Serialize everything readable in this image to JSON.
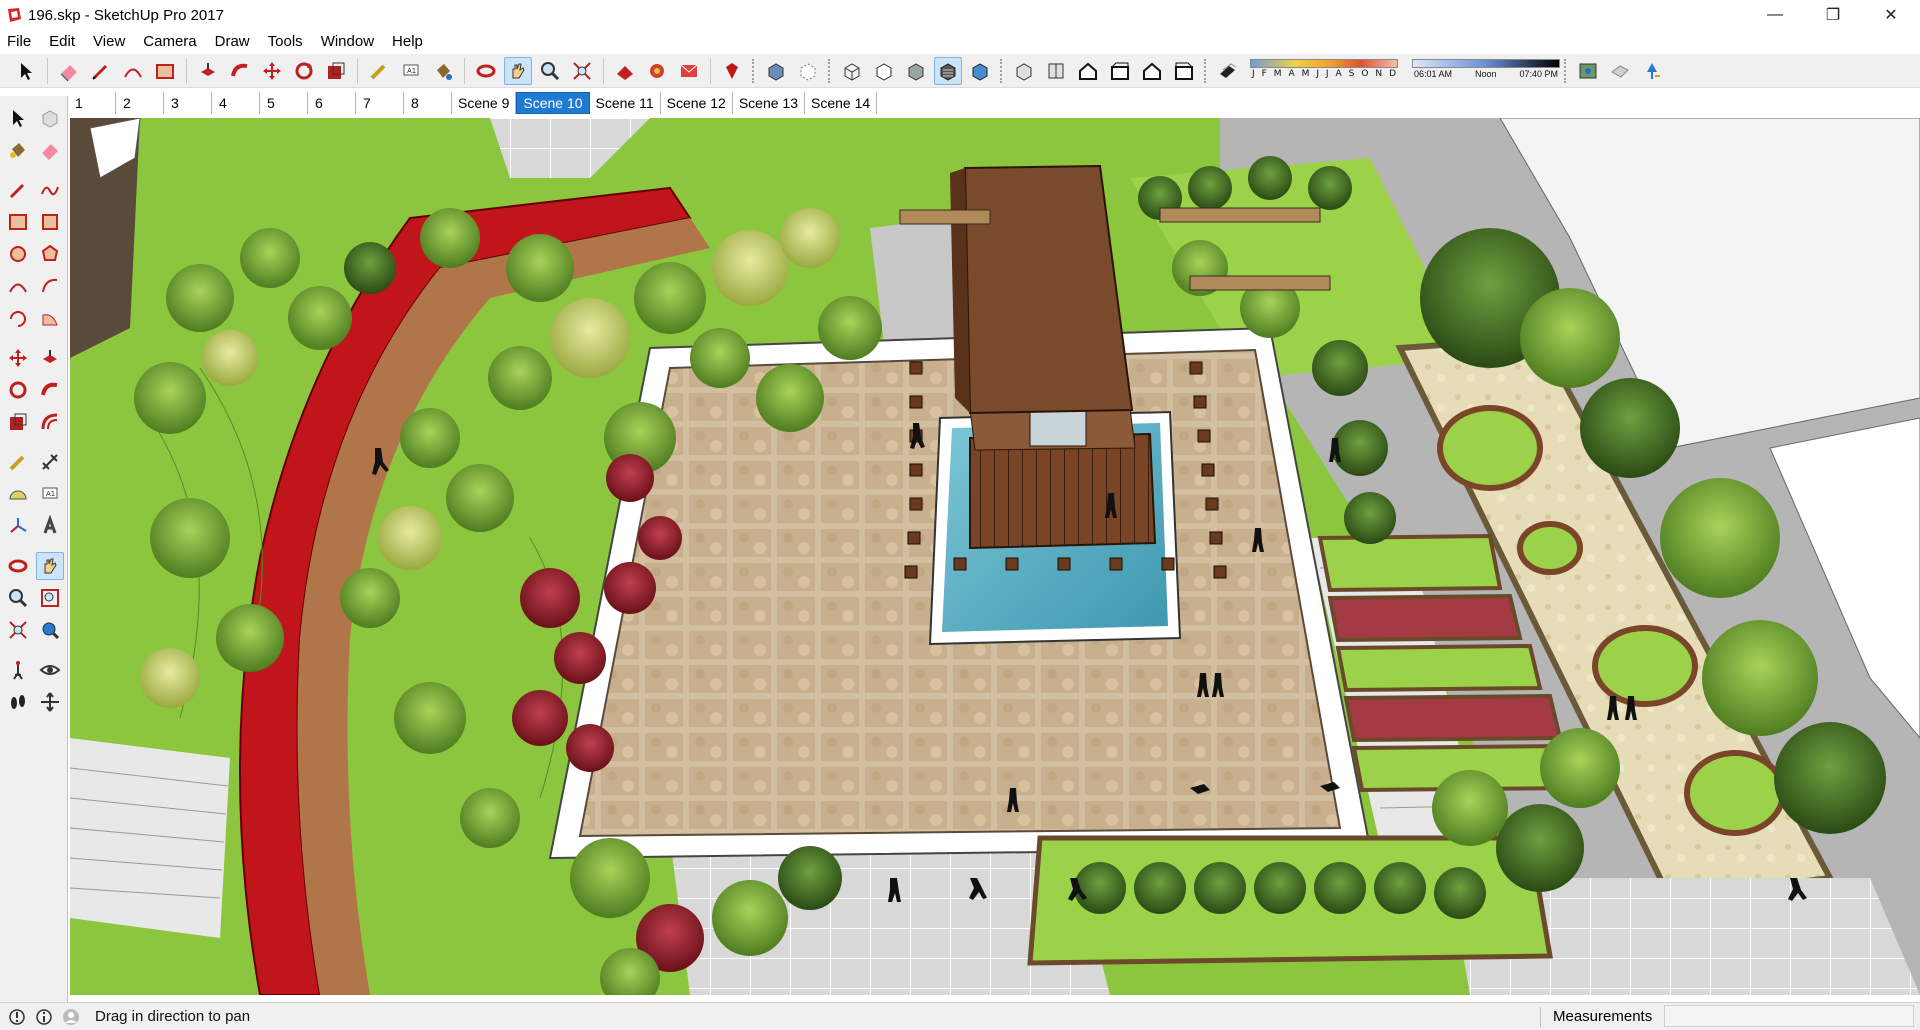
{
  "window": {
    "title": "196.skp - SketchUp Pro 2017",
    "minimize_glyph": "—",
    "maximize_glyph": "❐",
    "close_glyph": "✕"
  },
  "menu": [
    "File",
    "Edit",
    "View",
    "Camera",
    "Draw",
    "Tools",
    "Window",
    "Help"
  ],
  "shadows": {
    "months": [
      "J",
      "F",
      "M",
      "A",
      "M",
      "J",
      "J",
      "A",
      "S",
      "O",
      "N",
      "D"
    ],
    "time_start": "06:01 AM",
    "time_mid": "Noon",
    "time_end": "07:40 PM"
  },
  "scenes": {
    "tabs": [
      "1",
      "2",
      "3",
      "4",
      "5",
      "6",
      "7",
      "8",
      "Scene 9",
      "Scene 10",
      "Scene 11",
      "Scene 12",
      "Scene 13",
      "Scene 14"
    ],
    "active": "Scene 10"
  },
  "status": {
    "hint": "Drag in direction to pan",
    "measurements_label": "Measurements",
    "measurements_value": ""
  },
  "colors": {
    "accent": "#1e7ad2",
    "grass": "#8cc63f",
    "paving": "#c9b59a",
    "water": "#5fb3c7",
    "roof": "#7a4a2c",
    "red_wall": "#c0161b"
  },
  "icons": {
    "toolbar": [
      "select-icon",
      "eraser-icon",
      "pencil-icon",
      "arc-icon",
      "rectangle-icon",
      "push-pull-icon",
      "follow-me-icon",
      "move-icon",
      "rotate-icon",
      "scale-icon",
      "tape-measure-icon",
      "text-icon",
      "paint-bucket-icon",
      "orbit-icon",
      "pan-icon",
      "zoom-icon",
      "zoom-extents-icon",
      "warehouse-icon",
      "extension-icon",
      "share-icon",
      "ruby-icon",
      "xray-icon",
      "back-edges-icon",
      "wireframe-icon",
      "hidden-line-icon",
      "shaded-icon",
      "shaded-texture-icon",
      "monochrome-icon",
      "iso-view-icon",
      "top-view-icon",
      "front-view-icon",
      "right-view-icon",
      "back-view-icon",
      "left-view-icon",
      "shadows-toggle-icon",
      "geo-location-icon",
      "sandbox-icon",
      "north-arrow-icon"
    ]
  }
}
